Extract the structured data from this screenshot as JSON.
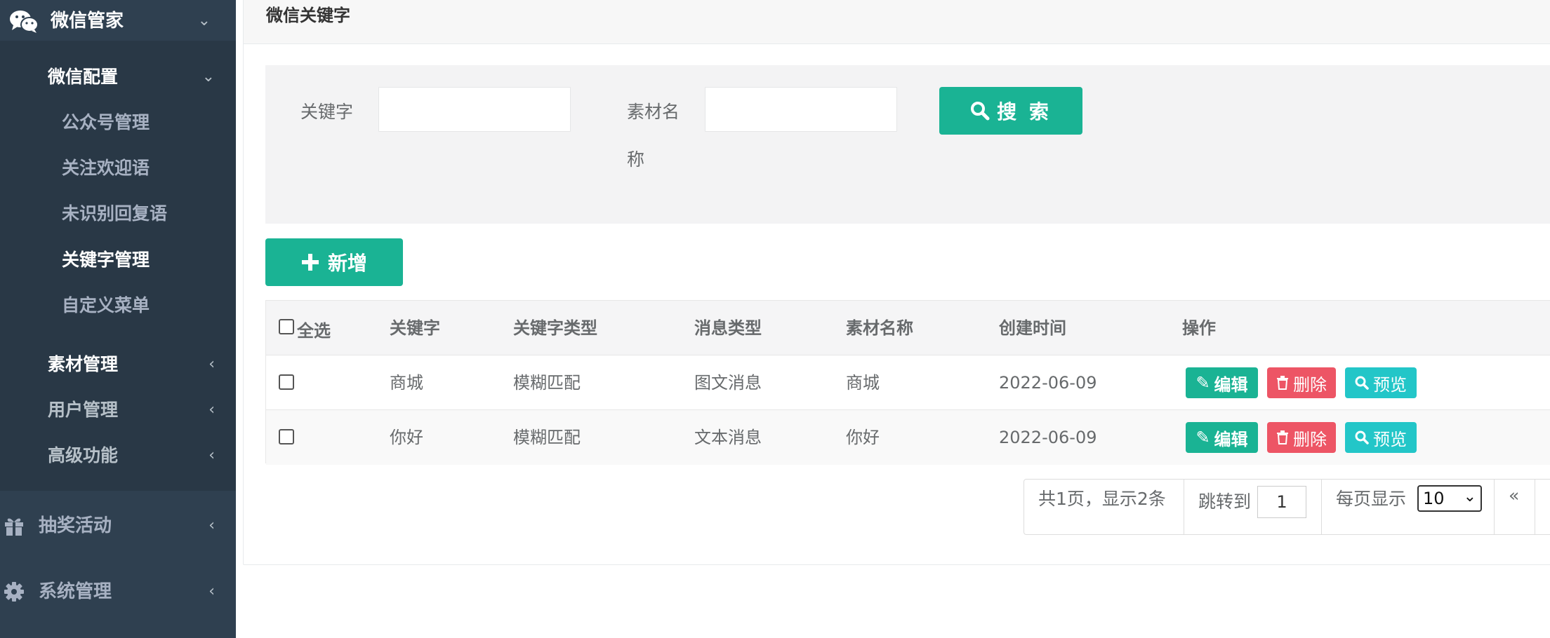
{
  "sidebar": {
    "top_item": {
      "label": "微信管家"
    },
    "config_group": {
      "label": "微信配置",
      "items": [
        {
          "label": "公众号管理"
        },
        {
          "label": "关注欢迎语"
        },
        {
          "label": "未识别回复语"
        },
        {
          "label": "关键字管理"
        },
        {
          "label": "自定义菜单"
        }
      ]
    },
    "other_groups": [
      {
        "label": "素材管理"
      },
      {
        "label": "用户管理"
      },
      {
        "label": "高级功能"
      }
    ],
    "bottom_items": [
      {
        "label": "抽奖活动",
        "icon": "gift-icon"
      },
      {
        "label": "系统管理",
        "icon": "gear-icon"
      }
    ]
  },
  "page": {
    "title": "微信关键字"
  },
  "search": {
    "keyword_label": "关键字",
    "keyword_value": "",
    "material_label_line1": "素材名",
    "material_label_line2": "称",
    "material_value": "",
    "search_button": "搜 索"
  },
  "toolbar": {
    "add_button": "新增"
  },
  "table": {
    "columns": [
      "全选",
      "关键字",
      "关键字类型",
      "消息类型",
      "素材名称",
      "创建时间",
      "操作"
    ],
    "rows": [
      {
        "keyword": "商城",
        "keyword_type": "模糊匹配",
        "msg_type": "图文消息",
        "material": "商城",
        "created": "2022-06-09"
      },
      {
        "keyword": "你好",
        "keyword_type": "模糊匹配",
        "msg_type": "文本消息",
        "material": "你好",
        "created": "2022-06-09"
      }
    ],
    "actions": {
      "edit": "编辑",
      "delete": "删除",
      "preview": "预览"
    }
  },
  "pagination": {
    "summary": "共1页，显示2条",
    "jump_label": "跳转到",
    "jump_value": "1",
    "per_page_label": "每页显示",
    "per_page_value": "10",
    "prev": "«"
  },
  "colors": {
    "sidebar_bg": "#2f4050",
    "sidebar_sub_bg": "#293846",
    "primary": "#1ab394",
    "danger": "#ed5565",
    "info": "#23c6c8"
  }
}
